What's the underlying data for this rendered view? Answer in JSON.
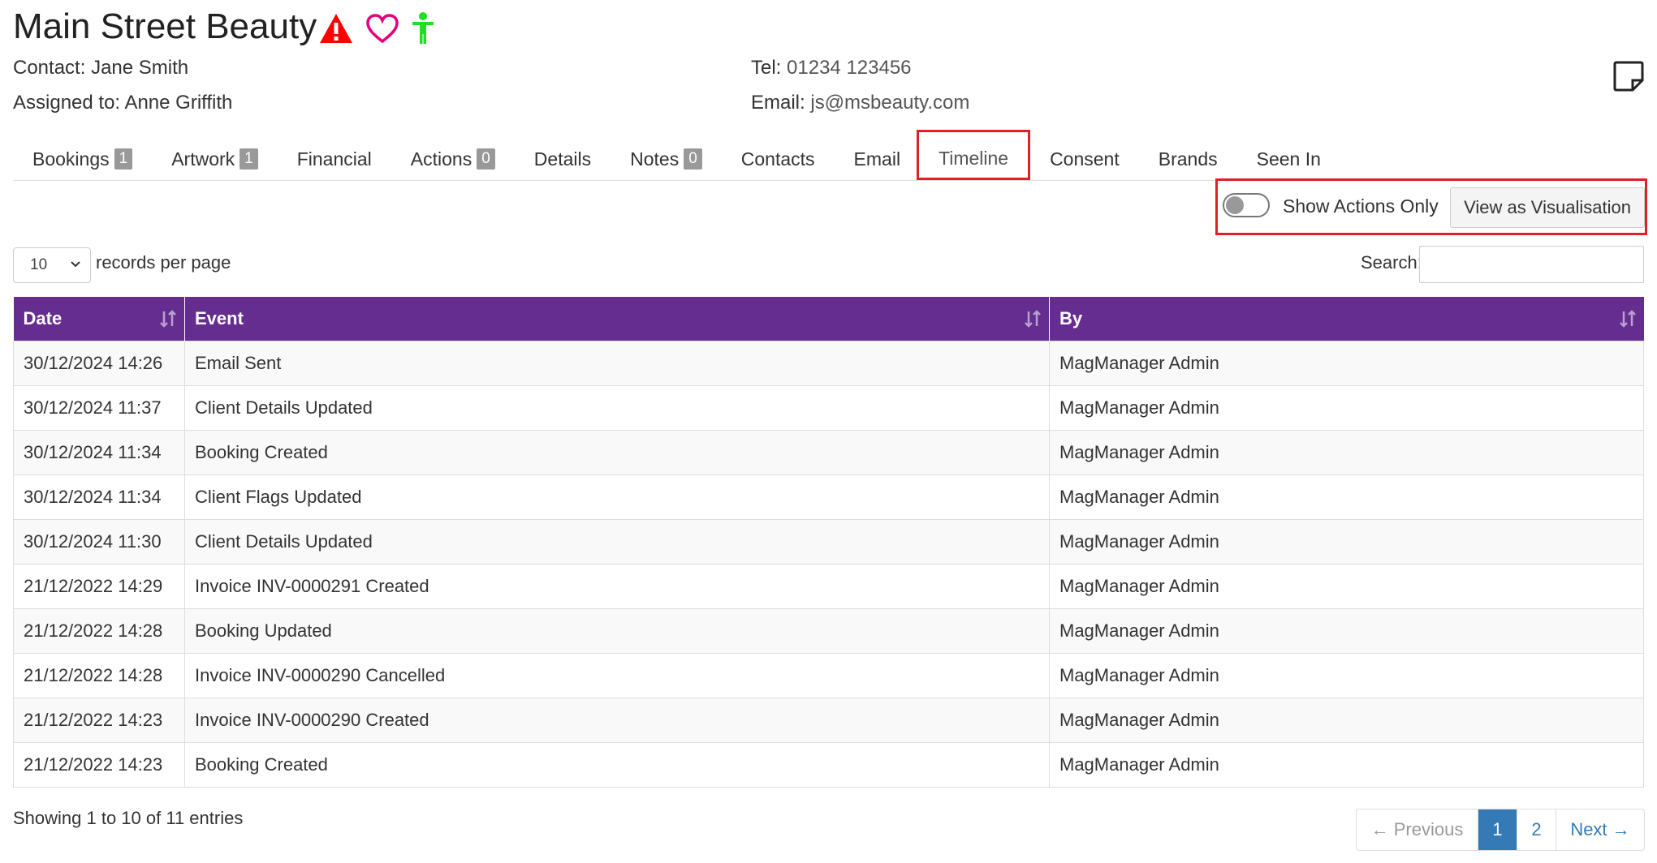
{
  "header": {
    "title": "Main Street Beauty",
    "contact_label": "Contact:",
    "contact_value": "Jane Smith",
    "assigned_label": "Assigned to:",
    "assigned_value": "Anne Griffith",
    "tel_label": "Tel:",
    "tel_value": "01234 123456",
    "email_label": "Email:",
    "email_value": "js@msbeauty.com",
    "icons": [
      "warning-triangle-icon",
      "heart-outline-icon",
      "person-icon",
      "sticky-note-icon"
    ],
    "colors": {
      "warning": "#ff0000",
      "heart": "#e4007c",
      "person": "#22dd22"
    }
  },
  "tabs": [
    {
      "label": "Bookings",
      "badge": "1"
    },
    {
      "label": "Artwork",
      "badge": "1"
    },
    {
      "label": "Financial",
      "badge": null
    },
    {
      "label": "Actions",
      "badge": "0"
    },
    {
      "label": "Details",
      "badge": null
    },
    {
      "label": "Notes",
      "badge": "0"
    },
    {
      "label": "Contacts",
      "badge": null
    },
    {
      "label": "Email",
      "badge": null
    },
    {
      "label": "Timeline",
      "badge": null,
      "active": true
    },
    {
      "label": "Consent",
      "badge": null
    },
    {
      "label": "Brands",
      "badge": null
    },
    {
      "label": "Seen In",
      "badge": null
    }
  ],
  "controls": {
    "toggle_label": "Show Actions Only",
    "toggle_on": false,
    "visualisation_button": "View as Visualisation",
    "highlight_color": "#e21e26"
  },
  "table_controls": {
    "records_per_page_value": "10",
    "records_per_page_label": "records per page",
    "search_label": "Search:",
    "search_value": ""
  },
  "table": {
    "header_color": "#662d91",
    "columns": [
      "Date",
      "Event",
      "By"
    ],
    "rows": [
      [
        "30/12/2024 14:26",
        "Email Sent",
        "MagManager Admin"
      ],
      [
        "30/12/2024 11:37",
        "Client Details Updated",
        "MagManager Admin"
      ],
      [
        "30/12/2024 11:34",
        "Booking Created",
        "MagManager Admin"
      ],
      [
        "30/12/2024 11:34",
        "Client Flags Updated",
        "MagManager Admin"
      ],
      [
        "30/12/2024 11:30",
        "Client Details Updated",
        "MagManager Admin"
      ],
      [
        "21/12/2022 14:29",
        "Invoice INV-0000291 Created",
        "MagManager Admin"
      ],
      [
        "21/12/2022 14:28",
        "Booking Updated",
        "MagManager Admin"
      ],
      [
        "21/12/2022 14:28",
        "Invoice INV-0000290 Cancelled",
        "MagManager Admin"
      ],
      [
        "21/12/2022 14:23",
        "Invoice INV-0000290 Created",
        "MagManager Admin"
      ],
      [
        "21/12/2022 14:23",
        "Booking Created",
        "MagManager Admin"
      ]
    ]
  },
  "footer": {
    "showing_text": "Showing 1 to 10 of 11 entries",
    "pagination": {
      "previous": "← Previous",
      "pages": [
        "1",
        "2"
      ],
      "current": "1",
      "next": "Next →"
    }
  }
}
